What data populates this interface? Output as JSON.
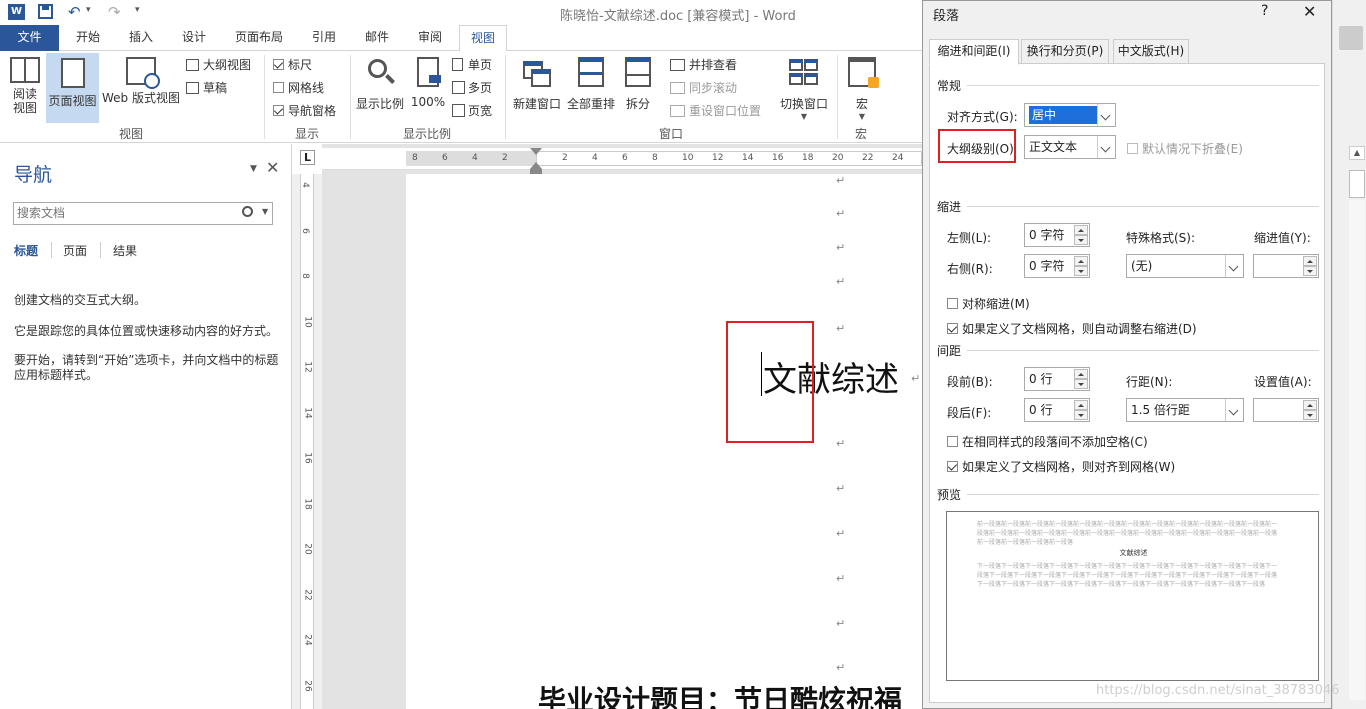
{
  "window": {
    "title": "陈晓怡-文献综述.doc [兼容模式] - Word"
  },
  "quick_access": {
    "undo_icon": "undo-icon",
    "redo_icon": "redo-icon",
    "customize": "▾"
  },
  "tabs": [
    "文件",
    "开始",
    "插入",
    "设计",
    "页面布局",
    "引用",
    "邮件",
    "审阅",
    "视图"
  ],
  "ribbon": {
    "views": {
      "read": "阅读\n视图",
      "print": "页面视图",
      "web": "Web 版式视图",
      "outline": "大纲视图",
      "draft": "草稿",
      "label": "视图"
    },
    "show": {
      "ruler": "标尺",
      "gridlines": "网格线",
      "navpane": "导航窗格",
      "label": "显示"
    },
    "zoom": {
      "zoom": "显示比例",
      "hundred": "100%",
      "one_page": "单页",
      "multi_page": "多页",
      "page_width": "页宽",
      "label": "显示比例"
    },
    "window": {
      "new_window": "新建窗口",
      "arrange_all": "全部重排",
      "split": "拆分",
      "side_by_side": "并排查看",
      "sync_scroll": "同步滚动",
      "reset_pos": "重设窗口位置",
      "switch": "切换窗口",
      "label": "窗口"
    },
    "macros": {
      "macros": "宏",
      "label": "宏"
    }
  },
  "nav": {
    "title": "导航",
    "search_placeholder": "搜索文档",
    "tabs": [
      "标题",
      "页面",
      "结果"
    ],
    "msg1": "创建文档的交互式大纲。",
    "msg2": "它是跟踪您的具体位置或快速移动内容的好方式。",
    "msg3": "要开始，请转到“开始”选项卡，并向文档中的标题应用标题样式。"
  },
  "ruler": {
    "corner": "L",
    "h_ticks": [
      "8",
      "6",
      "4",
      "2",
      "2",
      "4",
      "6",
      "8",
      "10",
      "12",
      "14",
      "16",
      "18",
      "20",
      "22",
      "24"
    ],
    "v_ticks": [
      "4",
      "6",
      "8",
      "10",
      "12",
      "14",
      "16",
      "18",
      "20",
      "22",
      "24",
      "26"
    ]
  },
  "document": {
    "heading": "文献综述",
    "bottom_text": "毕业设计题目：节日酷炫祝福",
    "pilcrow": "↵"
  },
  "dialog": {
    "title": "段落",
    "help": "?",
    "tabs": [
      "缩进和间距(I)",
      "换行和分页(P)",
      "中文版式(H)"
    ],
    "general": "常规",
    "alignment_label": "对齐方式(G):",
    "alignment_value": "居中",
    "outline_label": "大纲级别(O)",
    "outline_value": "正文文本",
    "collapse_label": "默认情况下折叠(E)",
    "indent": "缩进",
    "left_label": "左侧(L):",
    "left_value": "0 字符",
    "right_label": "右侧(R):",
    "right_value": "0 字符",
    "special_label": "特殊格式(S):",
    "special_value": "(无)",
    "indent_by_label": "缩进值(Y):",
    "mirror_label": "对称缩进(M)",
    "auto_adjust_label": "如果定义了文档网格，则自动调整右缩进(D)",
    "spacing": "间距",
    "before_label": "段前(B):",
    "before_value": "0 行",
    "after_label": "段后(F):",
    "after_value": "0 行",
    "line_spacing_label": "行距(N):",
    "line_spacing_value": "1.5 倍行距",
    "at_label": "设置值(A):",
    "no_space_label": "在相同样式的段落间不添加空格(C)",
    "snap_grid_label": "如果定义了文档网格，则对齐到网格(W)",
    "preview": "预览",
    "preview_prev": "前一段落前一段落前一段落前一段落前一段落前一段落前一段落前一段落前一段落前一段落前一段落前一段落前一段落前一段落前一段落前一段落前一段落前一段落前一段落前一段落前一段落前一段落前一段落前一段落前一段落前一段落前一段落前一段落前一段落",
    "preview_text": "文献综述",
    "preview_next": "下一段落下一段落下一段落下一段落下一段落下一段落下一段落下一段落下一段落下一段落下一段落下一段落下一段落下一段落下一段落下一段落下一段落下一段落下一段落下一段落下一段落下一段落下一段落下一段落下一段落下一段落下一段落下一段落下一段落下一段落下一段落下一段落下一段落下一段落下一段落下一段落下一段落"
  },
  "watermark": "https://blog.csdn.net/sinat_38783046",
  "colors": {
    "accent": "#2b579a",
    "highlight": "#e02020",
    "selection": "#1e6fd9"
  }
}
